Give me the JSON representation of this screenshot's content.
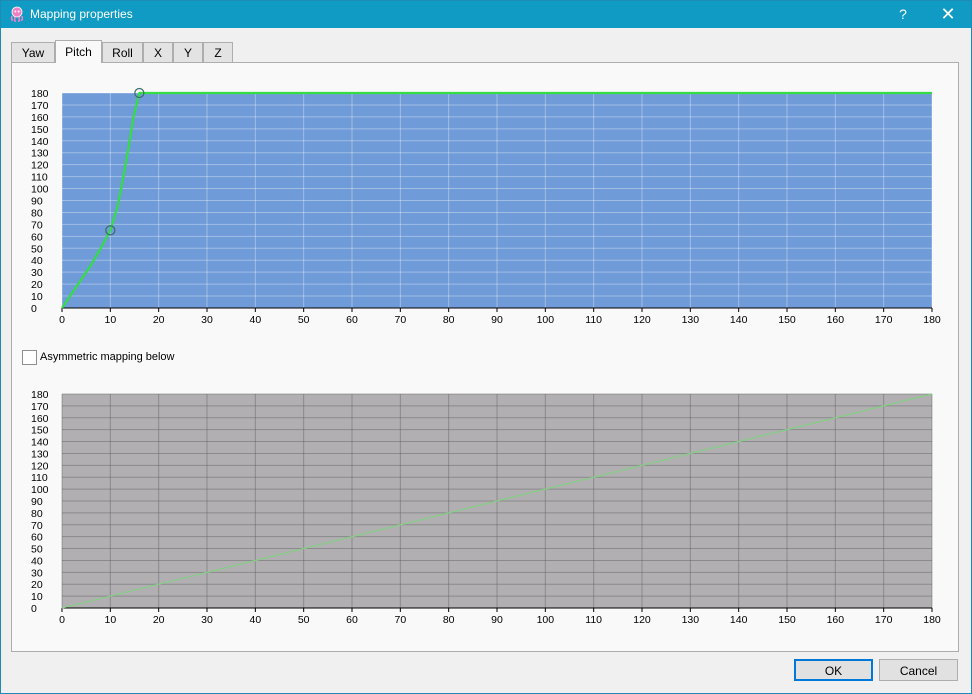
{
  "window": {
    "title": "Mapping properties",
    "help_glyph": "?",
    "close_glyph": "✕"
  },
  "tabs": [
    {
      "label": "Yaw",
      "active": false
    },
    {
      "label": "Pitch",
      "active": true
    },
    {
      "label": "Roll",
      "active": false
    },
    {
      "label": "X",
      "active": false
    },
    {
      "label": "Y",
      "active": false
    },
    {
      "label": "Z",
      "active": false
    }
  ],
  "asymmetric": {
    "label": "Asymmetric mapping below",
    "checked": false
  },
  "buttons": {
    "ok": "OK",
    "cancel": "Cancel"
  },
  "colors": {
    "top_plot_bg": "#6f9bd8",
    "bottom_plot_bg": "#b1afb2",
    "curve_active": "#33dd44",
    "curve_inactive": "#88cc88",
    "titlebar": "#0f9bc4"
  },
  "chart_data": [
    {
      "type": "line",
      "name": "pitch-mapping-curve",
      "xlim": [
        0,
        180
      ],
      "ylim": [
        0,
        180
      ],
      "xticks": [
        0,
        10,
        20,
        30,
        40,
        50,
        60,
        70,
        80,
        90,
        100,
        110,
        120,
        130,
        140,
        150,
        160,
        170,
        180
      ],
      "yticks": [
        0,
        10,
        20,
        30,
        40,
        50,
        60,
        70,
        80,
        90,
        100,
        110,
        120,
        130,
        140,
        150,
        160,
        170,
        180
      ],
      "grid": true,
      "control_points": [
        {
          "x": 0,
          "y": 0
        },
        {
          "x": 10,
          "y": 65
        },
        {
          "x": 16,
          "y": 180
        }
      ],
      "curve": [
        {
          "x": 0,
          "y": 0
        },
        {
          "x": 3,
          "y": 18
        },
        {
          "x": 6,
          "y": 36
        },
        {
          "x": 8,
          "y": 50
        },
        {
          "x": 10,
          "y": 65
        },
        {
          "x": 11.5,
          "y": 85
        },
        {
          "x": 12.7,
          "y": 110
        },
        {
          "x": 13.8,
          "y": 135
        },
        {
          "x": 14.8,
          "y": 160
        },
        {
          "x": 16,
          "y": 180
        },
        {
          "x": 180,
          "y": 180
        }
      ]
    },
    {
      "type": "line",
      "name": "asymmetric-mapping-curve",
      "xlim": [
        0,
        180
      ],
      "ylim": [
        0,
        180
      ],
      "xticks": [
        0,
        10,
        20,
        30,
        40,
        50,
        60,
        70,
        80,
        90,
        100,
        110,
        120,
        130,
        140,
        150,
        160,
        170,
        180
      ],
      "yticks": [
        0,
        10,
        20,
        30,
        40,
        50,
        60,
        70,
        80,
        90,
        100,
        110,
        120,
        130,
        140,
        150,
        160,
        170,
        180
      ],
      "grid": true,
      "control_points": [],
      "curve": [
        {
          "x": 0,
          "y": 0
        },
        {
          "x": 180,
          "y": 180
        }
      ]
    }
  ]
}
